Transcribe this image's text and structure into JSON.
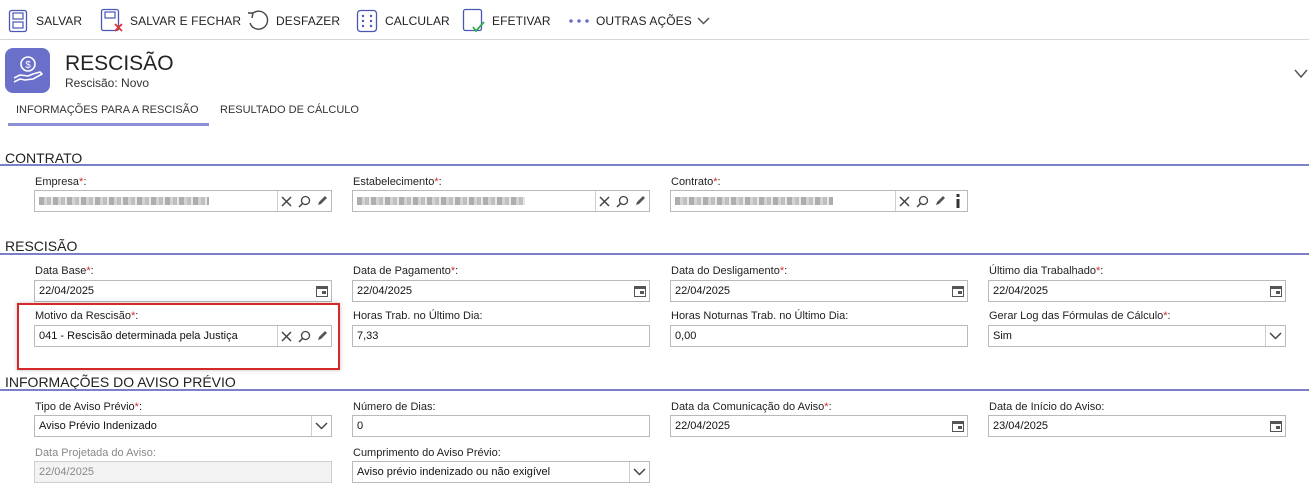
{
  "toolbar": {
    "save_label": "SALVAR",
    "save_close_label": "SALVAR E FECHAR",
    "undo_label": "DESFAZER",
    "calculate_label": "CALCULAR",
    "effectuate_label": "EFETIVAR",
    "more_actions_label": "OUTRAS AÇÕES"
  },
  "header": {
    "title": "RESCISÃO",
    "subtitle": "Rescisão: Novo",
    "icon": "hand-coin-icon",
    "accent_color": "#6a70c9"
  },
  "tabs": [
    {
      "label": "INFORMAÇÕES PARA A RESCISÃO",
      "active": true
    },
    {
      "label": "RESULTADO DE CÁLCULO",
      "active": false
    }
  ],
  "sections": {
    "contrato": {
      "title": "CONTRATO",
      "empresa": {
        "label": "Empresa",
        "required": true,
        "value": ""
      },
      "estabelecimento": {
        "label": "Estabelecimento",
        "required": true,
        "value": ""
      },
      "contrato": {
        "label": "Contrato",
        "required": true,
        "value": ""
      }
    },
    "rescisao": {
      "title": "RESCISÃO",
      "data_base": {
        "label": "Data Base",
        "required": true,
        "value": "22/04/2025"
      },
      "data_pagamento": {
        "label": "Data de Pagamento",
        "required": true,
        "value": "22/04/2025"
      },
      "data_desligamento": {
        "label": "Data do Desligamento",
        "required": true,
        "value": "22/04/2025"
      },
      "ultimo_dia": {
        "label": "Último dia Trabalhado",
        "required": true,
        "value": "22/04/2025"
      },
      "motivo": {
        "label": "Motivo da Rescisão",
        "required": true,
        "value": "041 - Rescisão determinada pela Justiça"
      },
      "horas_trab": {
        "label": "Horas Trab. no Último Dia:",
        "required": false,
        "value": "7,33"
      },
      "horas_noturnas": {
        "label": "Horas Noturnas Trab. no Último Dia:",
        "required": false,
        "value": "0,00"
      },
      "gerar_log": {
        "label": "Gerar Log das Fórmulas de Cálculo",
        "required": true,
        "value": "Sim"
      }
    },
    "aviso": {
      "title": "INFORMAÇÕES DO AVISO PRÉVIO",
      "tipo": {
        "label": "Tipo de Aviso Prévio",
        "required": true,
        "value": "Aviso Prévio Indenizado"
      },
      "numero_dias": {
        "label": "Número de Dias:",
        "required": false,
        "value": "0"
      },
      "data_comunicacao": {
        "label": "Data da Comunicação do Aviso",
        "required": true,
        "value": "22/04/2025"
      },
      "data_inicio": {
        "label": "Data de Início do Aviso:",
        "required": false,
        "value": "23/04/2025"
      },
      "data_projetada": {
        "label": "Data Projetada do Aviso:",
        "required": false,
        "value": "22/04/2025"
      },
      "cumprimento": {
        "label": "Cumprimento do Aviso Prévio:",
        "required": false,
        "value": "Aviso prévio indenizado ou não exigível"
      }
    }
  },
  "required_mark": "*",
  "label_suffix": ":"
}
